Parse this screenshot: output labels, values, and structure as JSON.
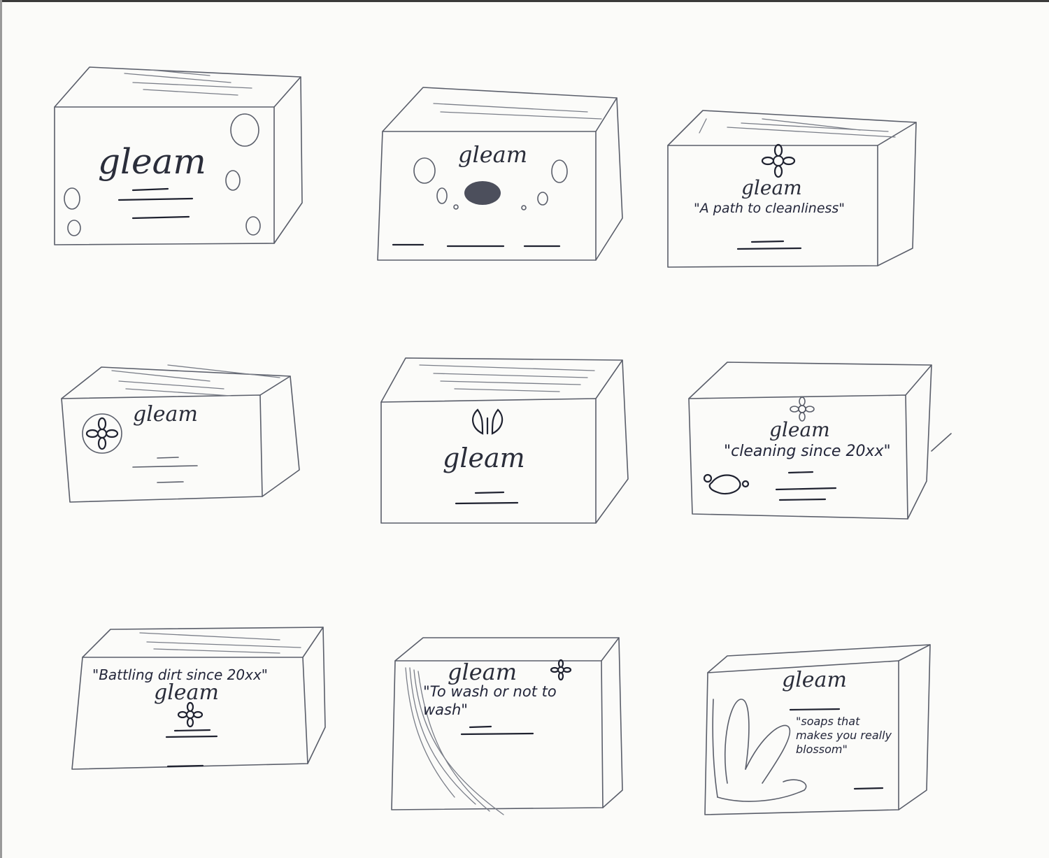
{
  "sketches": [
    {
      "brand": "gleam",
      "slogan": ""
    },
    {
      "brand": "gleam",
      "slogan": ""
    },
    {
      "brand": "gleam",
      "slogan": "\"A path to cleanliness\""
    },
    {
      "brand": "gleam",
      "slogan": ""
    },
    {
      "brand": "gleam",
      "slogan": ""
    },
    {
      "brand": "gleam",
      "slogan": "\"cleaning since 20xx\""
    },
    {
      "brand": "gleam",
      "slogan": "\"Battling dirt since 20xx\""
    },
    {
      "brand": "gleam",
      "slogan": "\"To wash or not to wash\""
    },
    {
      "brand": "gleam",
      "slogan": "\"soaps that makes you really blossom\""
    }
  ],
  "colors": {
    "paper": "#fbfbf9",
    "pencil": "#5a5e6a",
    "ink": "#1f2230"
  }
}
